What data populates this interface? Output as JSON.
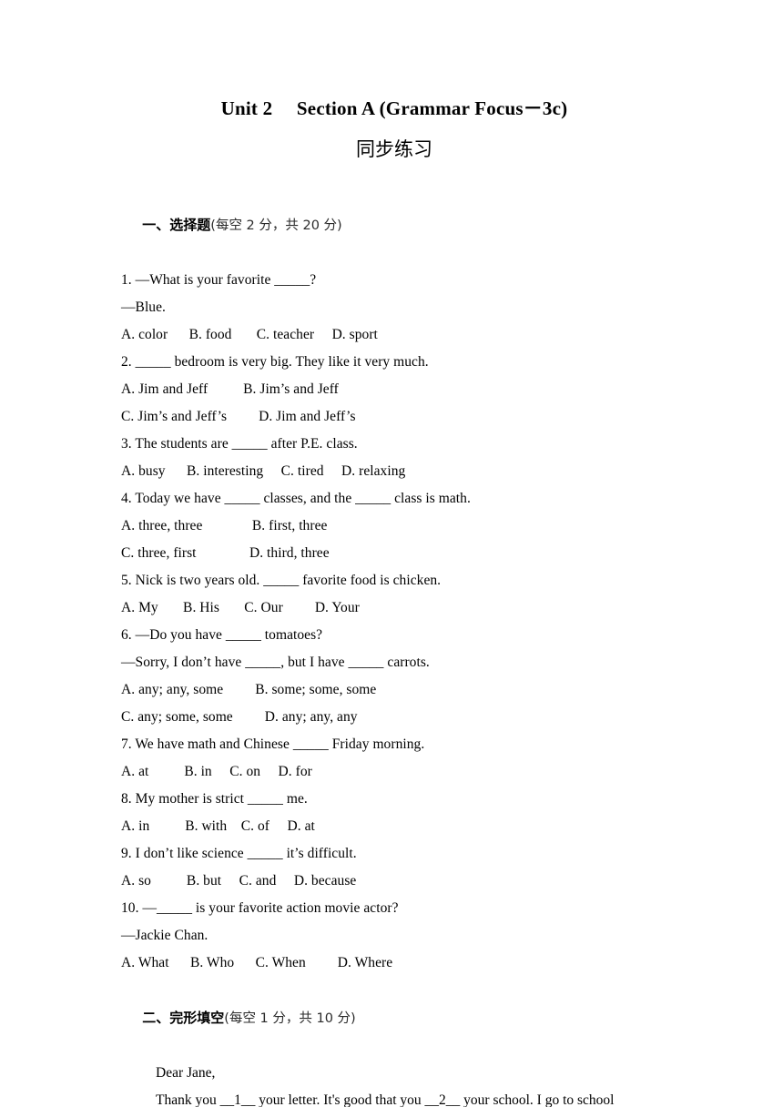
{
  "document": {
    "title": "Unit 2  Section A (Grammar Focus－3c)",
    "subtitle": "同步练习"
  },
  "sections": [
    {
      "id": "section-one",
      "number": "一、",
      "name": "选择题",
      "points": "(每空 2 分，共 20 分)",
      "lines": [
        "1. —What is your favorite _____?",
        "—Blue.",
        "A. color   B. food    C. teacher  D. sport",
        "2. _____ bedroom is very big. They like it very much.",
        "A. Jim and Jeff    B. Jim’s and Jeff",
        "C. Jim’s and Jeff’s   D. Jim and Jeff’s",
        "3. The students are _____ after P.E. class.",
        "A. busy   B. interesting  C. tired  D. relaxing",
        "4. Today we have _____ classes, and the _____ class is math.",
        "A. three, three     B. first, three",
        "C. three, first      D. third, three",
        "5. Nick is two years old. _____ favorite food is chicken.",
        "A. My    B. His    C. Our   D. Your",
        "6. —Do you have _____ tomatoes?",
        "—Sorry, I don’t have _____, but I have _____ carrots.",
        "A. any; any, some   B. some; some, some",
        "C. any; some, some   D. any; any, any",
        "7. We have math and Chinese _____ Friday morning.",
        "A. at    B. in  C. on  D. for",
        "8. My mother is strict _____ me.",
        "A. in    B. with C. of  D. at",
        "9. I don’t like science _____ it’s difficult.",
        "A. so    B. but  C. and  D. because",
        "10. —_____ is your favorite action movie actor?",
        "—Jackie Chan.",
        "A. What   B. Who   C. When   D. Where"
      ]
    },
    {
      "id": "section-two",
      "number": "二、",
      "name": "完形填空",
      "points": "(每空 1 分，共 10 分)",
      "passage": [
        "Dear Jane,",
        "Thank you __1__ your letter. It's good that you __2__ your school. I go to school"
      ]
    }
  ]
}
